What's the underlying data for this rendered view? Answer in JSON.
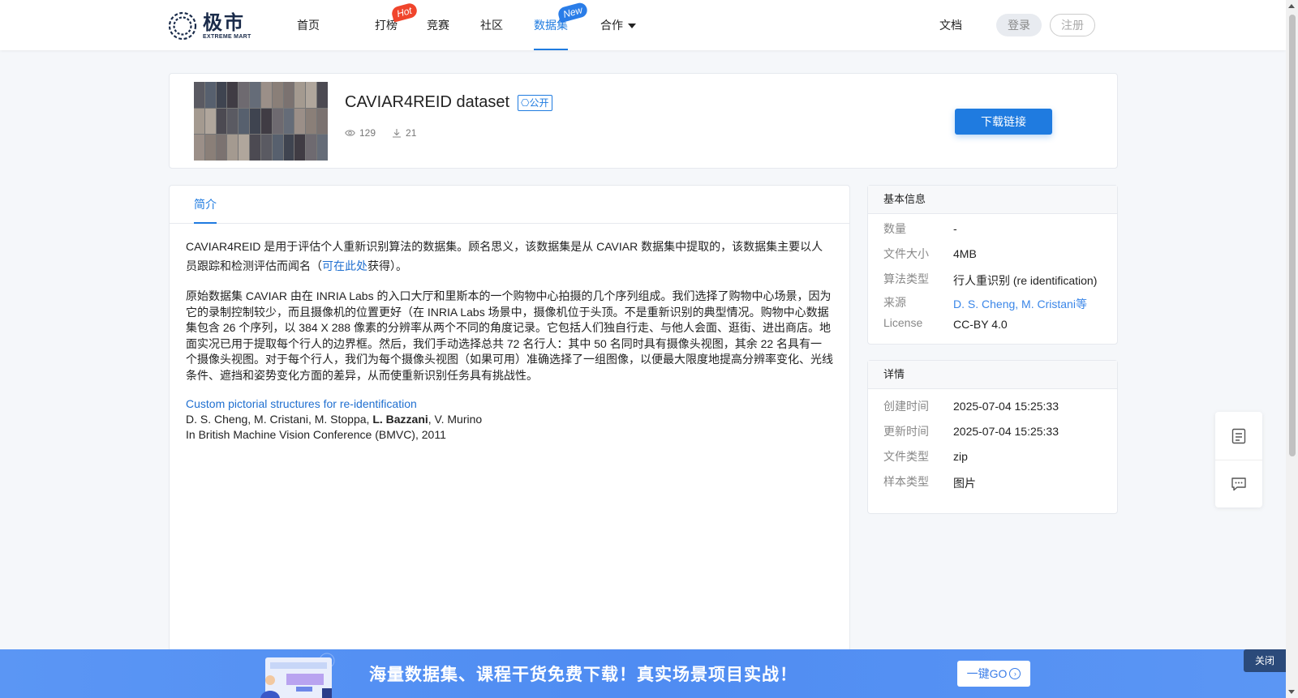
{
  "header": {
    "logo_cn": "极市",
    "logo_en": "EXTREME MART",
    "nav": [
      {
        "label": "首页",
        "badge": ""
      },
      {
        "label": "打榜",
        "badge": "Hot"
      },
      {
        "label": "竞赛",
        "badge": ""
      },
      {
        "label": "社区",
        "badge": ""
      },
      {
        "label": "数据集",
        "badge": "New"
      },
      {
        "label": "合作",
        "badge": ""
      }
    ],
    "docs": "文档",
    "login": "登录",
    "register": "注册"
  },
  "dataset": {
    "title": "CAVIAR4REID dataset",
    "visibility": "公开",
    "views": "129",
    "downloads": "21",
    "download_button": "下载链接"
  },
  "tabs": {
    "intro": "简介"
  },
  "intro": {
    "p1_before": "CAVIAR4REID 是用于评估个人重新识别算法的数据集。顾名思义，该数据集是从 CAVIAR 数据集中提取的，该数据集主要以人员跟踪和检测评估而闻名（",
    "p1_link": "可在此处",
    "p1_after": "获得）。",
    "p2": "原始数据集 CAVIAR 由在 INRIA Labs 的入口大厅和里斯本的一个购物中心拍摄的几个序列组成。我们选择了购物中心场景，因为它的录制控制较少，而且摄像机的位置更好（在 INRIA Labs 场景中，摄像机位于头顶。不是重新识别的典型情况。购物中心数据集包含 26 个序列，以 384 X 288 像素的分辨率从两个不同的角度记录。它包括人们独自行走、与他人会面、逛街、进出商店。地面实况已用于提取每个行人的边界框。然后，我们手动选择总共 72 名行人：其中 50 名同时具有摄像头视图，其余 22 名具有一个摄像头视图。对于每个行人，我们为每个摄像头视图（如果可用）准确选择了一组图像，以便最大限度地提高分辨率变化、光线条件、遮挡和姿势变化方面的差异，从而使重新识别任务具有挑战性。",
    "ref_title": "Custom pictorial structures for re-identification",
    "ref_authors_before": "D. S. Cheng, M. Cristani, M. Stoppa, ",
    "ref_authors_bold": "L. Bazzani",
    "ref_authors_after": ", V. Murino",
    "ref_venue": "In British Machine Vision Conference (BMVC), 2011"
  },
  "basic_info": {
    "heading": "基本信息",
    "rows": [
      {
        "label": "数量",
        "value": "-"
      },
      {
        "label": "文件大小",
        "value": "4MB"
      },
      {
        "label": "算法类型",
        "value": "行人重识别 (re identification)"
      },
      {
        "label": "来源",
        "value": "D. S. Cheng, M. Cristani等"
      },
      {
        "label": "License",
        "value": "CC-BY 4.0"
      }
    ]
  },
  "details": {
    "heading": "详情",
    "rows": [
      {
        "label": "创建时间",
        "value": "2025-07-04 15:25:33"
      },
      {
        "label": "更新时间",
        "value": "2025-07-04 15:25:33"
      },
      {
        "label": "文件类型",
        "value": "zip"
      },
      {
        "label": "样本类型",
        "value": "图片"
      }
    ]
  },
  "banner": {
    "text": "海量数据集、课程干货免费下载！真实场景项目实战！",
    "go_button": "一键GO",
    "close": "关闭"
  },
  "colors": {
    "accent": "#1f7be0",
    "hot_badge": "#f0452c",
    "banner": "#4f8cf2"
  },
  "icons": {
    "views": "eye-icon",
    "downloads": "download-icon",
    "notes": "document-icon",
    "feedback": "chat-icon"
  }
}
